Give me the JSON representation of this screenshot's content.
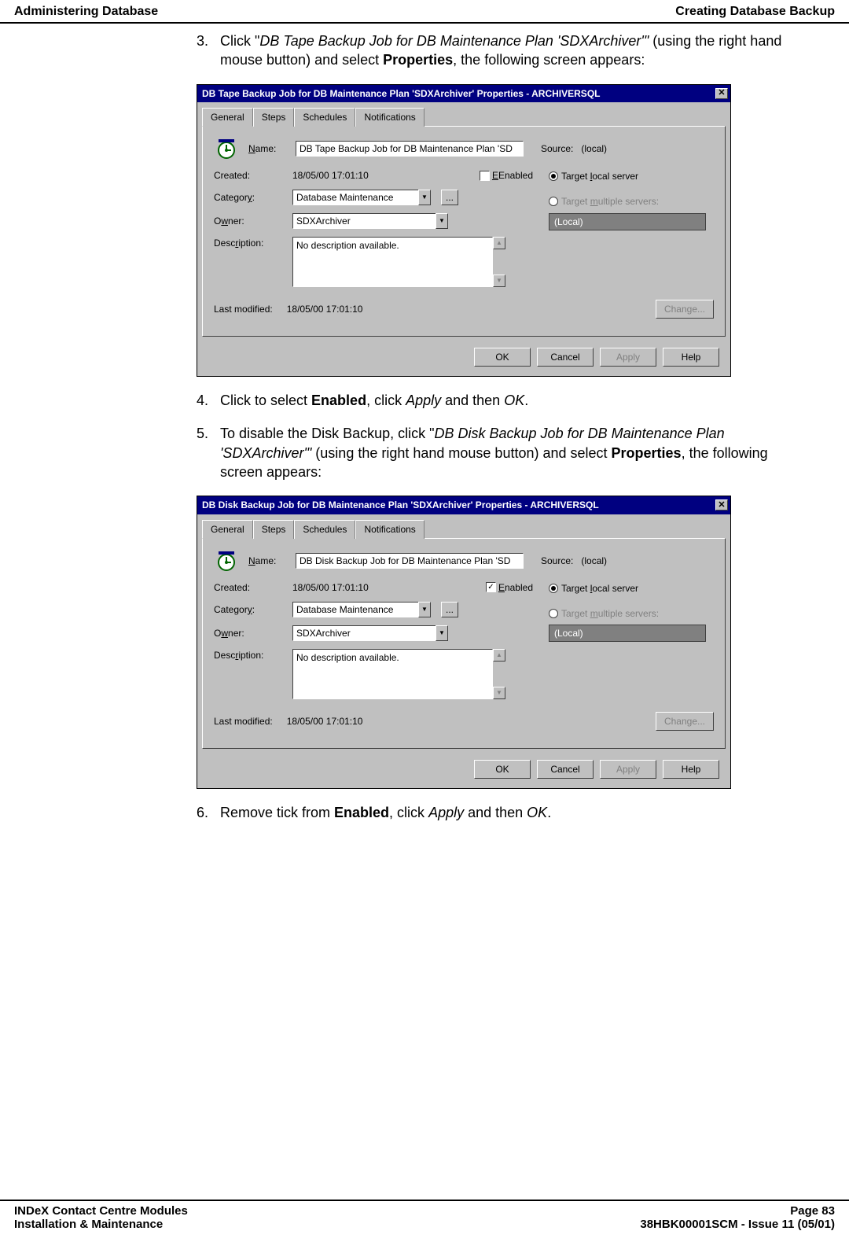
{
  "header": {
    "left": "Administering Database",
    "right": "Creating Database Backup"
  },
  "steps": {
    "s3_num": "3.",
    "s3_a": "Click \"",
    "s3_b_italic": "DB Tape Backup Job for DB Maintenance Plan 'SDXArchiver'\"",
    "s3_c": " (using the right hand mouse button) and select ",
    "s3_d_bold": "Properties",
    "s3_e": ", the following screen appears:",
    "s4_num": "4.",
    "s4_a": "Click to select ",
    "s4_b_bold": "Enabled",
    "s4_c": ", click ",
    "s4_d_italic": "Apply",
    "s4_e": " and then ",
    "s4_f_italic": "OK",
    "s4_g": ".",
    "s5_num": "5.",
    "s5_a": "To disable the Disk Backup, click \"",
    "s5_b_italic": "DB Disk Backup Job for DB Maintenance Plan 'SDXArchiver'\"",
    "s5_c": " (using the right hand mouse button) and select ",
    "s5_d_bold": "Properties",
    "s5_e": ", the following screen appears:",
    "s6_num": "6.",
    "s6_a": "Remove tick from ",
    "s6_b_bold": "Enabled",
    "s6_c": ", click ",
    "s6_d_italic": "Apply",
    "s6_e": " and then ",
    "s6_f_italic": "OK",
    "s6_g": "."
  },
  "dialog1": {
    "title": "DB Tape Backup Job for DB Maintenance Plan 'SDXArchiver' Properties - ARCHIVERSQL",
    "tabs": {
      "general": "General",
      "steps": "Steps",
      "schedules": "Schedules",
      "notifications": "Notifications"
    },
    "labels": {
      "name": "Name:",
      "created": "Created:",
      "category": "Category:",
      "owner": "Owner:",
      "description": "Description:",
      "last_modified": "Last modified:",
      "source": "Source:"
    },
    "values": {
      "name": "DB Tape Backup Job for DB Maintenance Plan 'SD",
      "created": "18/05/00 17:01:10",
      "category": "Database Maintenance",
      "owner": "SDXArchiver",
      "description": "No description available.",
      "last_modified": "18/05/00 17:01:10",
      "source": "(local)"
    },
    "enabled_label": "Enabled",
    "enabled_checked": false,
    "radios": {
      "local": "Target local server",
      "multi": "Target multiple servers:",
      "multi_box": "(Local)"
    },
    "buttons": {
      "change": "Change...",
      "ok": "OK",
      "cancel": "Cancel",
      "apply": "Apply",
      "help": "Help"
    }
  },
  "dialog2": {
    "title": "DB Disk Backup Job for DB Maintenance Plan 'SDXArchiver' Properties - ARCHIVERSQL",
    "tabs": {
      "general": "General",
      "steps": "Steps",
      "schedules": "Schedules",
      "notifications": "Notifications"
    },
    "labels": {
      "name": "Name:",
      "created": "Created:",
      "category": "Category:",
      "owner": "Owner:",
      "description": "Description:",
      "last_modified": "Last modified:",
      "source": "Source:"
    },
    "values": {
      "name": "DB Disk Backup Job for DB Maintenance Plan 'SD",
      "created": "18/05/00 17:01:10",
      "category": "Database Maintenance",
      "owner": "SDXArchiver",
      "description": "No description available.",
      "last_modified": "18/05/00 17:01:10",
      "source": "(local)"
    },
    "enabled_label": "Enabled",
    "enabled_checked": true,
    "radios": {
      "local": "Target local server",
      "multi": "Target multiple servers:",
      "multi_box": "(Local)"
    },
    "buttons": {
      "change": "Change...",
      "ok": "OK",
      "cancel": "Cancel",
      "apply": "Apply",
      "help": "Help"
    }
  },
  "footer": {
    "left1": "INDeX Contact Centre Modules",
    "left2": "Installation & Maintenance",
    "right1": "Page 83",
    "right2": "38HBK00001SCM - Issue 11 (05/01)"
  }
}
